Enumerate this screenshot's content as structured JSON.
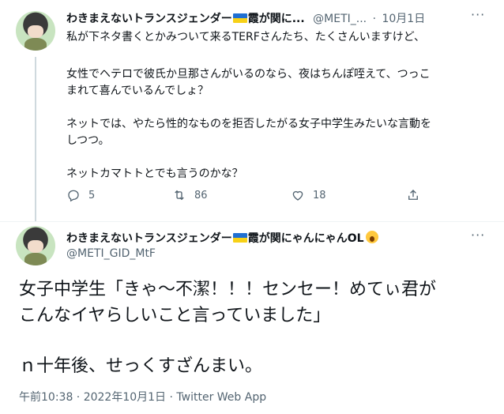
{
  "tweet1": {
    "display_name": "わきまえないトランスジェンダー",
    "display_name_suffix": "霞が関に...",
    "handle": "@METI_...",
    "dot": "·",
    "date": "10月1日",
    "more": "···",
    "lines": [
      "私が下ネタ書くとかみついて来るTERFさんたち、たくさんいますけど、",
      "女性でヘテロで彼氏か旦那さんがいるのなら、夜はちんぽ咥えて、つっこ",
      "まれて喜んでいるんでしょ？",
      "ネットでは、やたら性的なものを拒否したがる女子中学生みたいな言動を",
      "しつつ。",
      "ネットカマトトとでも言うのかな？"
    ],
    "replies": "5",
    "retweets": "86",
    "likes": "18"
  },
  "tweet2": {
    "display_name": "わきまえないトランスジェンダー",
    "display_name_suffix": "霞が関にゃんにゃんOL",
    "handle": "@METI_GID_MtF",
    "more": "···",
    "lines": [
      "女子中学生「きゃ～不潔！！！センセー！めてぃ君が",
      "こんなイヤらしいこと言っていました」",
      "ｎ十年後、せっくすざんまい。"
    ],
    "footer": "午前10:38 · 2022年10月1日 · Twitter Web App"
  },
  "colors": {
    "text": "#0f1419",
    "muted": "#536471",
    "divider": "#eff3f4",
    "thread": "#cfd9de"
  }
}
